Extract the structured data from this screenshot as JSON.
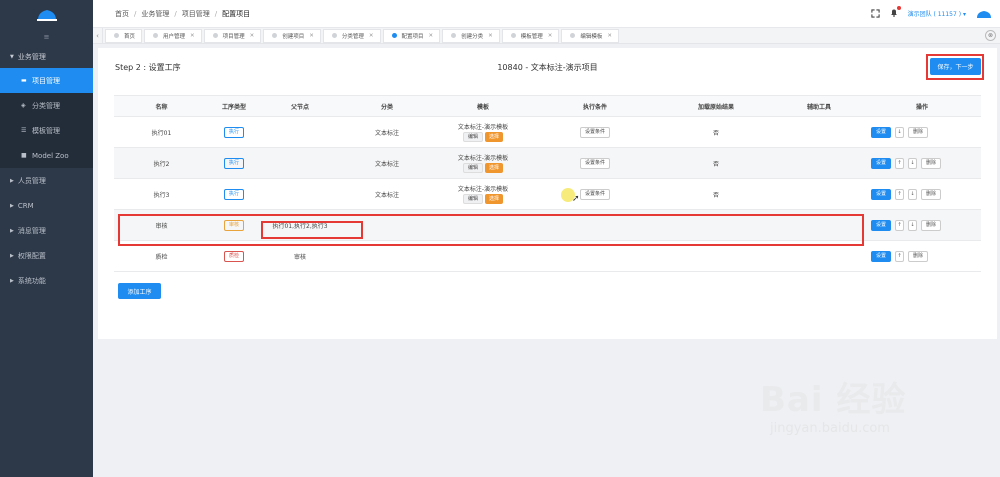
{
  "colors": {
    "accent": "#1e8cf0",
    "sidebar": "#2d3848",
    "highlight": "#e53935",
    "pick": "#f0962f"
  },
  "sidebar": {
    "collapse_icon": "≡",
    "group": {
      "label": "业务管理",
      "items": [
        {
          "label": "项目管理",
          "icon": "monitor-icon",
          "active": true
        },
        {
          "label": "分类管理",
          "icon": "cube-icon"
        },
        {
          "label": "模板管理",
          "icon": "template-icon"
        },
        {
          "label": "Model Zoo",
          "icon": "doc-icon"
        }
      ]
    },
    "menus": [
      "人员管理",
      "CRM",
      "消息管理",
      "权限配置",
      "系统功能"
    ]
  },
  "header": {
    "breadcrumb": [
      "首页",
      "业务管理",
      "项目管理",
      "配置项目"
    ],
    "user_label": "演示团队 ( 11157 ) ▾"
  },
  "tabs": [
    "首页",
    "用户管理",
    "项目管理",
    "创建项目",
    "分类管理",
    "配置项目",
    "创建分类",
    "模板管理",
    "编辑模板"
  ],
  "page": {
    "step_title": "Step 2 : 设置工序",
    "project_title": "10840 - 文本标注-演示项目",
    "save_label": "保存，下一步",
    "add_label": "添加工序"
  },
  "table": {
    "headers": [
      "名称",
      "工序类型",
      "父节点",
      "分类",
      "模板",
      "执行条件",
      "加载原始结果",
      "辅助工具",
      "操作"
    ],
    "rows": [
      {
        "name": "执行01",
        "type": "执行",
        "parent": "",
        "category": "文本标注",
        "template": "文本标注-演示模板",
        "cond": "设置条件",
        "load": "否"
      },
      {
        "name": "执行2",
        "type": "执行",
        "parent": "",
        "category": "文本标注",
        "template": "文本标注-演示模板",
        "cond": "设置条件",
        "load": "否"
      },
      {
        "name": "执行3",
        "type": "执行",
        "parent": "",
        "category": "文本标注",
        "template": "文本标注-演示模板",
        "cond": "设置条件",
        "load": "否"
      },
      {
        "name": "审核",
        "type": "审核",
        "parent": "执行01,执行2,执行3",
        "category": "",
        "template": "",
        "cond": "",
        "load": ""
      },
      {
        "name": "质检",
        "type": "质检",
        "parent": "审核",
        "category": "",
        "template": "",
        "cond": "",
        "load": ""
      }
    ],
    "edit_label": "编辑",
    "pick_label": "选择",
    "set_label": "设置",
    "del_label": "删除",
    "up": "↑",
    "down": "↓"
  },
  "watermark": {
    "main": "Bai 经验",
    "sub": "jingyan.baidu.com"
  }
}
